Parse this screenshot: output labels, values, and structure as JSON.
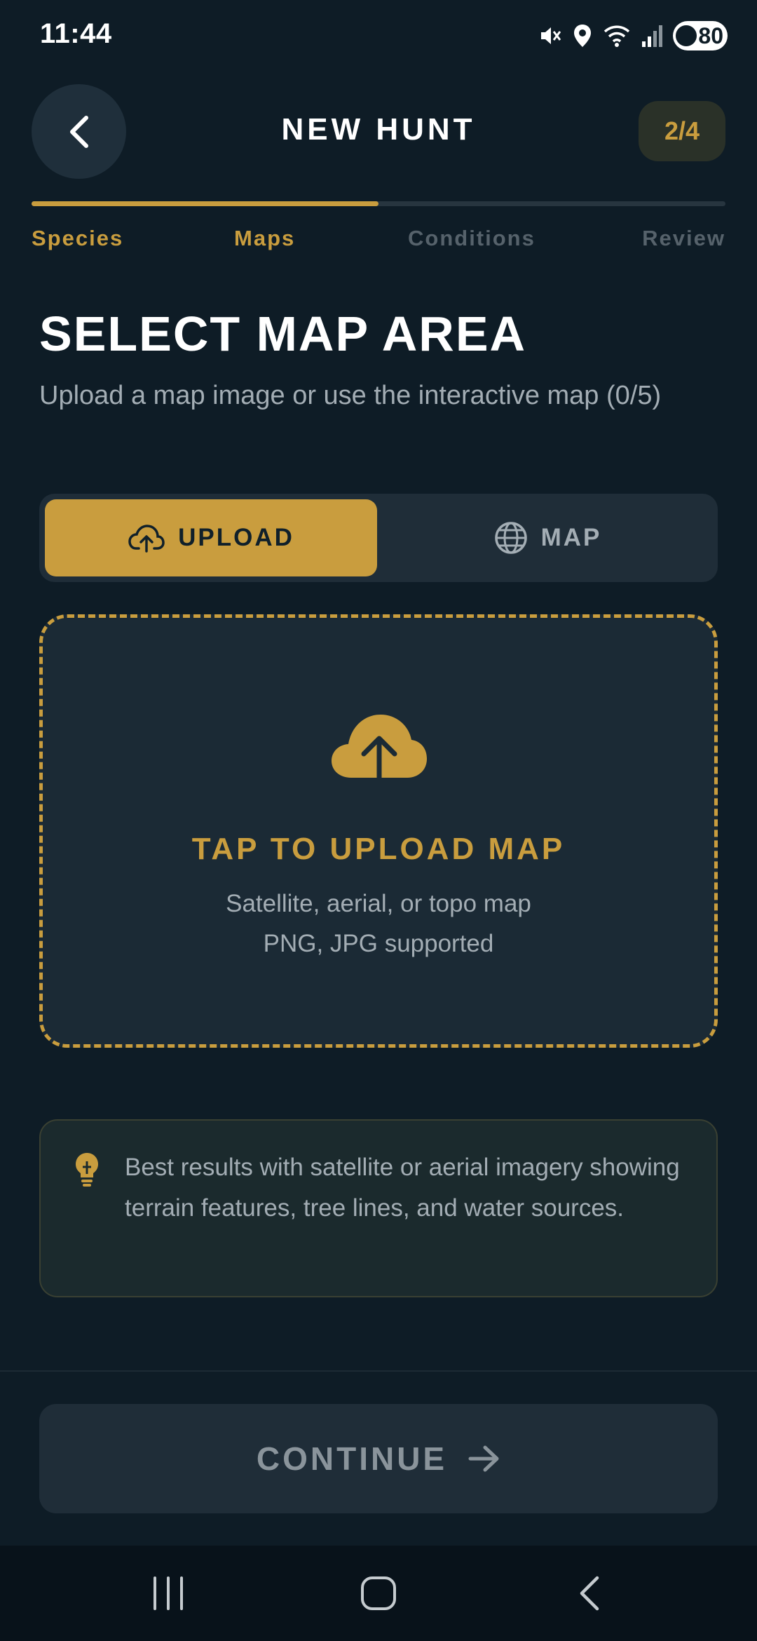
{
  "status_bar": {
    "time": "11:44",
    "battery": "80",
    "icons": [
      "mute-icon",
      "location-icon",
      "wifi-icon",
      "signal-icon",
      "battery-icon"
    ]
  },
  "header": {
    "title": "NEW HUNT",
    "step_badge": "2/4",
    "back_icon": "chevron-left-icon"
  },
  "progress": {
    "fraction": 0.5,
    "steps": [
      {
        "label": "Species",
        "state": "active"
      },
      {
        "label": "Maps",
        "state": "active"
      },
      {
        "label": "Conditions",
        "state": "inactive"
      },
      {
        "label": "Review",
        "state": "inactive"
      }
    ]
  },
  "section": {
    "title": "SELECT MAP AREA",
    "subtitle": "Upload a map image or use the interactive map (0/5)"
  },
  "segmented": {
    "upload_label": "UPLOAD",
    "map_label": "MAP",
    "selected": "upload"
  },
  "dropzone": {
    "title": "TAP TO UPLOAD MAP",
    "line1": "Satellite, aerial, or topo map",
    "line2": "PNG, JPG supported"
  },
  "tip": {
    "icon": "lightbulb-icon",
    "text": "Best results with satellite or aerial imagery showing terrain features, tree lines, and water sources."
  },
  "footer": {
    "continue_label": "CONTINUE"
  },
  "colors": {
    "background": "#0e1c26",
    "accent": "#c99d3e",
    "surface": "#1f2d38",
    "muted_text": "#a3adb4"
  }
}
